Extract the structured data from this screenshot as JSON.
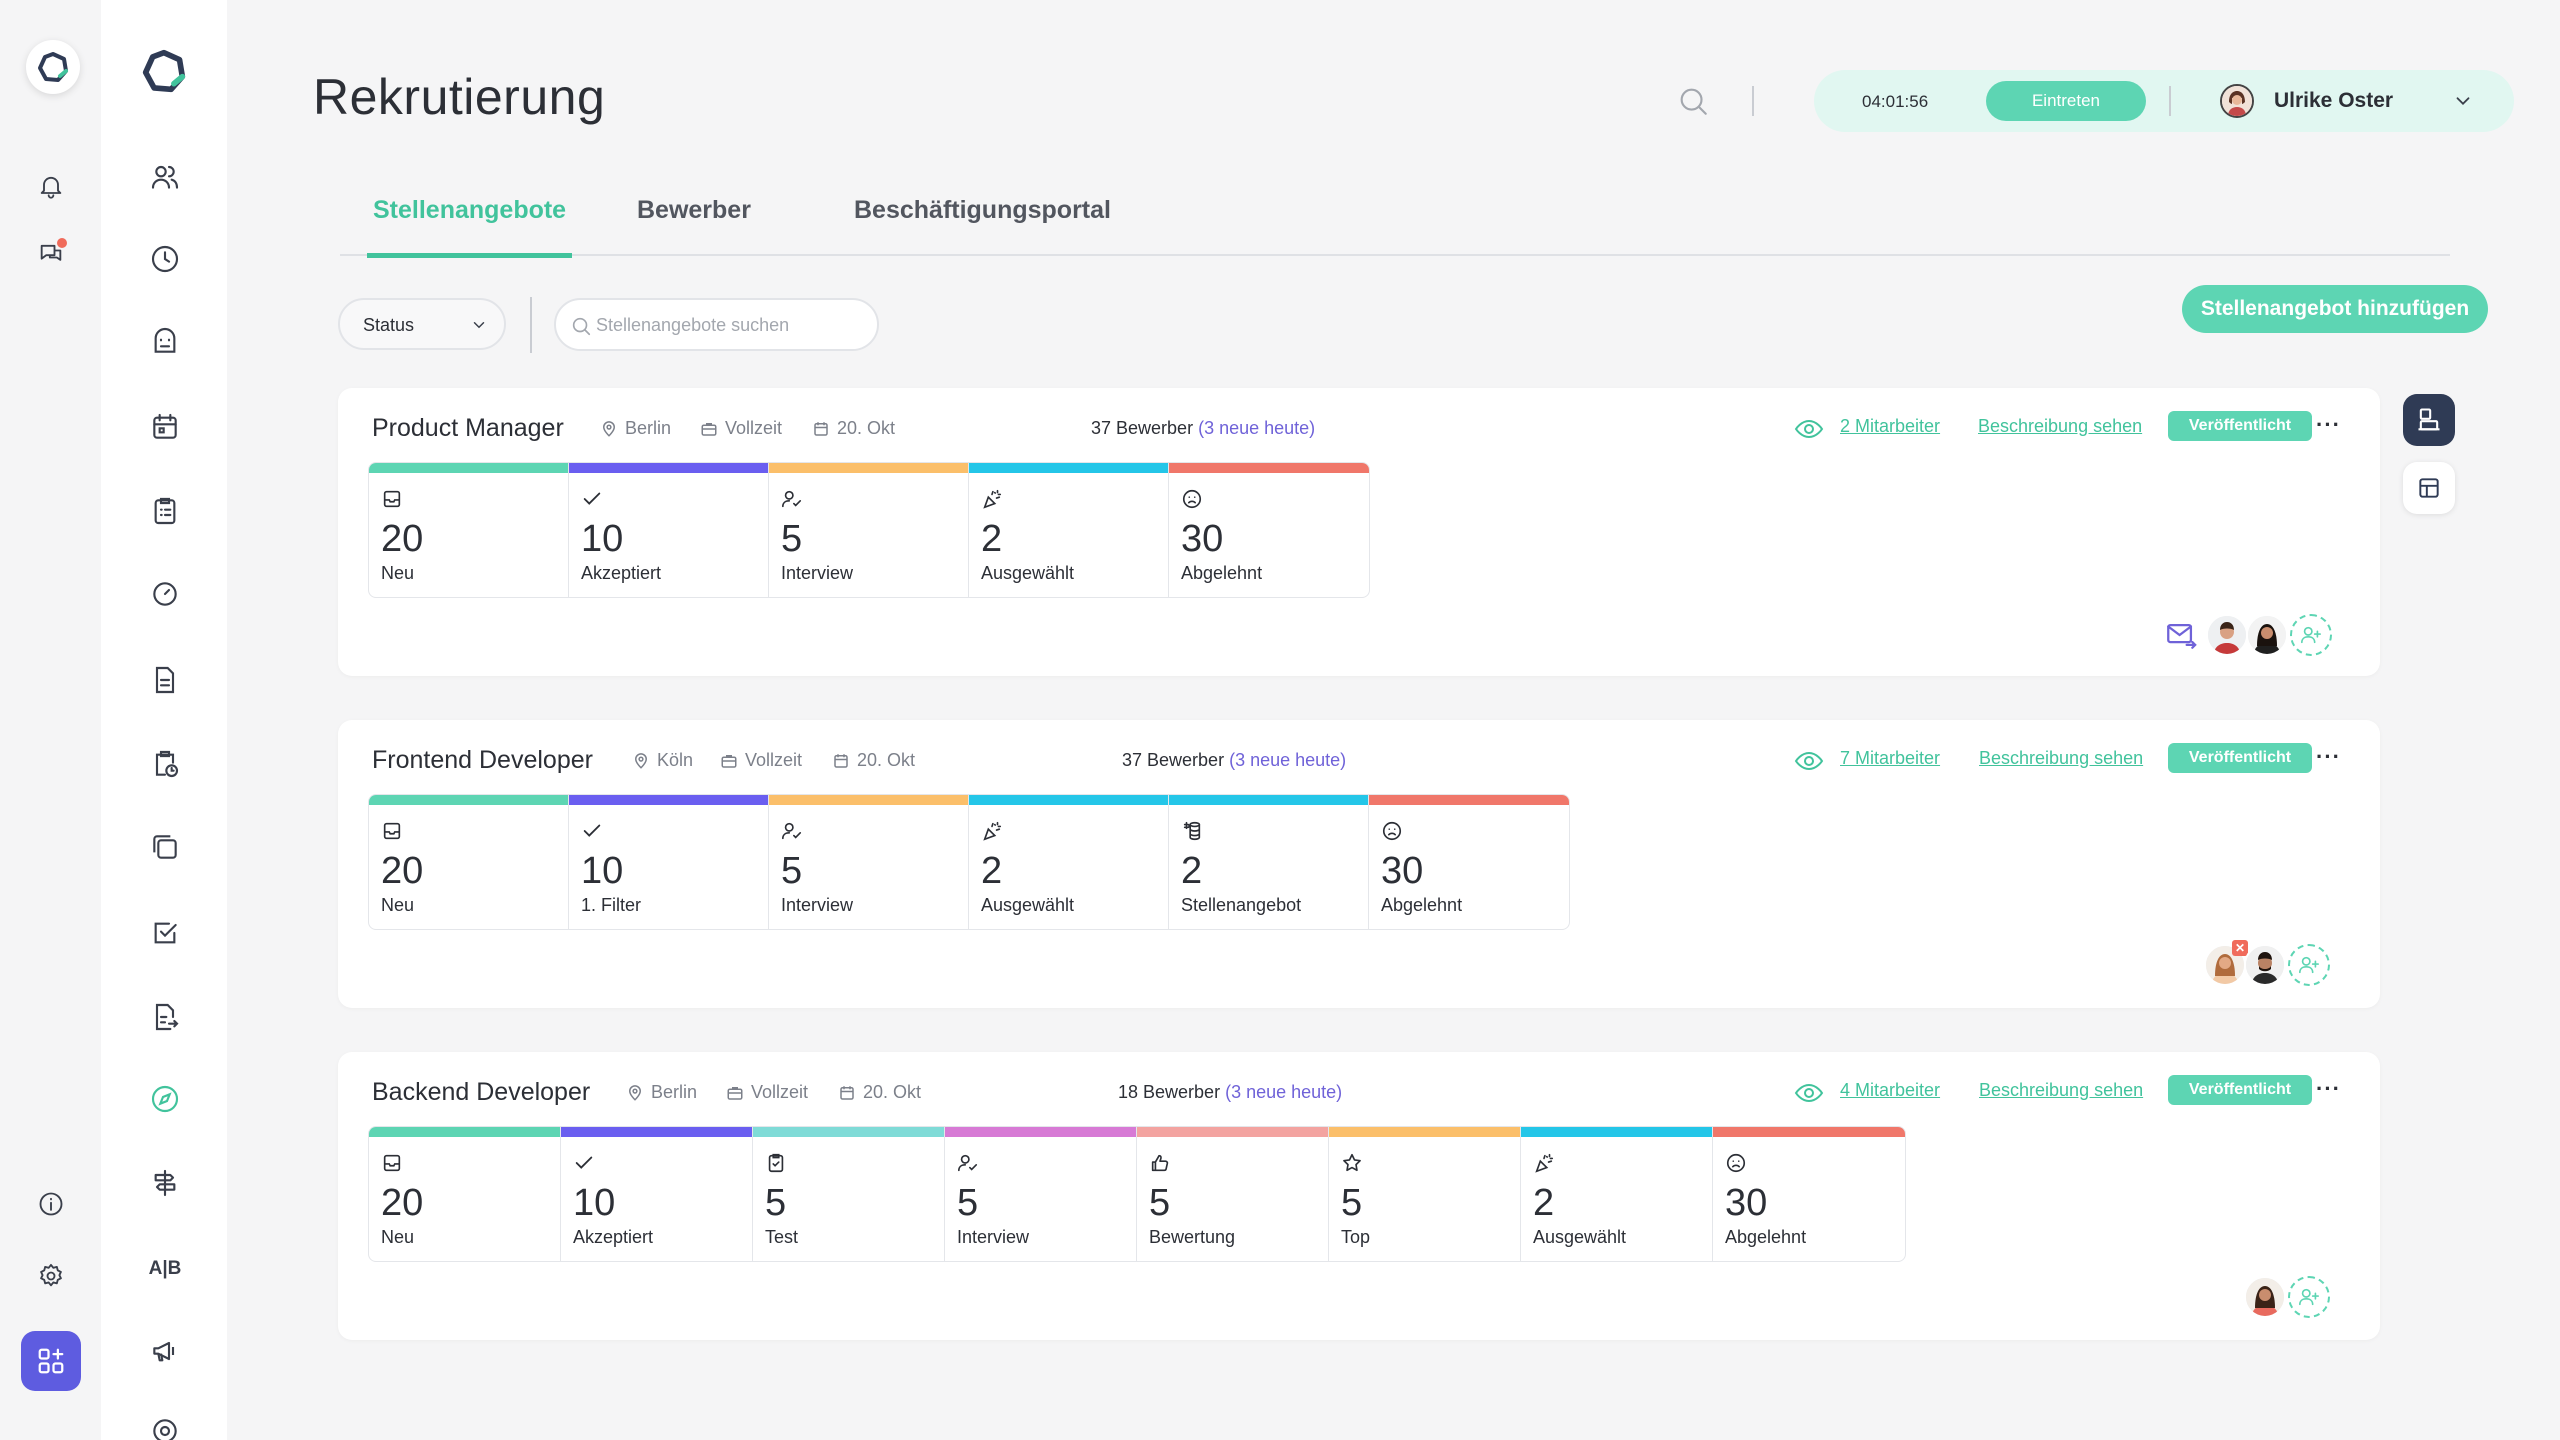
{
  "header": {
    "title": "Rekrutierung",
    "timer": "04:01:56",
    "enter_label": "Eintreten",
    "user_name": "Ulrike Oster"
  },
  "tabs": [
    {
      "label": "Stellenangebote",
      "active": true
    },
    {
      "label": "Bewerber",
      "active": false
    },
    {
      "label": "Beschäftigungsportal",
      "active": false
    }
  ],
  "filters": {
    "status_label": "Status",
    "search_placeholder": "Stellenangebote suchen",
    "add_button": "Stellenangebot hinzufügen"
  },
  "colors": {
    "accent": "#41c39c",
    "accent_light": "#5dd5b3",
    "purple": "#6f62d8",
    "stage_neu": "#5dd5b3",
    "stage_akzeptiert": "#6a5ef0",
    "stage_interview": "#fbbf6a",
    "stage_ausgewaehlt": "#24c6e8",
    "stage_abgelehnt": "#f0776a",
    "stage_test": "#7fdbd7",
    "stage_bewertung_start": "#d77ad5",
    "stage_bewertung": "#f3a3a0",
    "stage_top": "#fbbf6a"
  },
  "jobs": [
    {
      "title": "Product Manager",
      "location": "Berlin",
      "type": "Vollzeit",
      "date": "20. Okt",
      "applicants": "37 Bewerber",
      "applicants_new": "(3 neue heute)",
      "employees": "2 Mitarbeiter",
      "description_link": "Beschreibung sehen",
      "status": "Veröffentlicht",
      "stages": [
        {
          "icon": "inbox-icon",
          "count": "20",
          "label": "Neu"
        },
        {
          "icon": "check-icon",
          "count": "10",
          "label": "Akzeptiert"
        },
        {
          "icon": "user-check-icon",
          "count": "5",
          "label": "Interview"
        },
        {
          "icon": "party-icon",
          "count": "2",
          "label": "Ausgewählt"
        },
        {
          "icon": "frown-icon",
          "count": "30",
          "label": "Abgelehnt"
        }
      ]
    },
    {
      "title": "Frontend Developer",
      "location": "Köln",
      "type": "Vollzeit",
      "date": "20. Okt",
      "applicants": "37 Bewerber",
      "applicants_new": "(3 neue heute)",
      "employees": "7 Mitarbeiter",
      "description_link": "Beschreibung sehen",
      "status": "Veröffentlicht",
      "stages": [
        {
          "icon": "inbox-icon",
          "count": "20",
          "label": "Neu"
        },
        {
          "icon": "check-icon",
          "count": "10",
          "label": "1. Filter"
        },
        {
          "icon": "user-check-icon",
          "count": "5",
          "label": "Interview"
        },
        {
          "icon": "party-icon",
          "count": "2",
          "label": "Ausgewählt"
        },
        {
          "icon": "money-icon",
          "count": "2",
          "label": "Stellenangebot"
        },
        {
          "icon": "frown-icon",
          "count": "30",
          "label": "Abgelehnt"
        }
      ]
    },
    {
      "title": "Backend Developer",
      "location": "Berlin",
      "type": "Vollzeit",
      "date": "20. Okt",
      "applicants": "18 Bewerber",
      "applicants_new": "(3 neue heute)",
      "employees": "4 Mitarbeiter",
      "description_link": "Beschreibung sehen",
      "status": "Veröffentlicht",
      "stages": [
        {
          "icon": "inbox-icon",
          "count": "20",
          "label": "Neu"
        },
        {
          "icon": "check-icon",
          "count": "10",
          "label": "Akzeptiert"
        },
        {
          "icon": "clipboard-check-icon",
          "count": "5",
          "label": "Test"
        },
        {
          "icon": "user-check-icon",
          "count": "5",
          "label": "Interview"
        },
        {
          "icon": "thumbs-up-icon",
          "count": "5",
          "label": "Bewertung"
        },
        {
          "icon": "star-icon",
          "count": "5",
          "label": "Top"
        },
        {
          "icon": "party-icon",
          "count": "2",
          "label": "Ausgewählt"
        },
        {
          "icon": "frown-icon",
          "count": "30",
          "label": "Abgelehnt"
        }
      ]
    }
  ],
  "sidebar": {
    "ab_label": "A|B"
  }
}
